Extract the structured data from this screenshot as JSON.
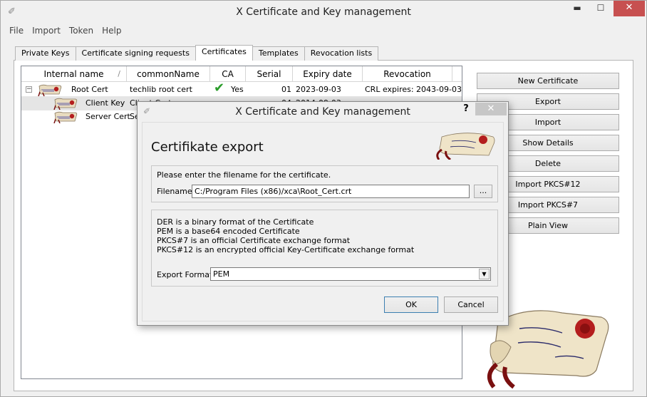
{
  "window": {
    "title": "X Certificate and Key management",
    "minimize": "▬",
    "maximize": "☐",
    "close": "✕"
  },
  "menu": [
    "File",
    "Import",
    "Token",
    "Help"
  ],
  "tabs": [
    "Private Keys",
    "Certificate signing requests",
    "Certificates",
    "Templates",
    "Revocation lists"
  ],
  "active_tab": "Certificates",
  "table": {
    "columns": [
      "Internal name",
      "commonName",
      "CA",
      "Serial",
      "Expiry date",
      "Revocation"
    ],
    "sort_indicator": "/",
    "rows": [
      {
        "name": "Root Cert",
        "cn": "techlib root cert",
        "ca": "Yes",
        "serial": "01",
        "expiry": "2023-09-03",
        "revocation": "CRL expires: 2043-09-03",
        "expander": "−"
      },
      {
        "name": "Client Key",
        "cn": "Client Cert",
        "ca": "",
        "serial": "04",
        "expiry": "2014-09-03",
        "revocation": ""
      },
      {
        "name": "Server Cert",
        "cn": "Se",
        "ca": "",
        "serial": "",
        "expiry": "",
        "revocation": ""
      }
    ]
  },
  "buttons": [
    "New Certificate",
    "Export",
    "Import",
    "Show Details",
    "Delete",
    "Import PKCS#12",
    "Import PKCS#7",
    "Plain View"
  ],
  "dialog": {
    "title": "X Certificate and Key management",
    "help": "?",
    "close": "✕",
    "heading": "Certifikate export",
    "prompt": "Please enter the filename for the certificate.",
    "filename_label": "Filename",
    "filename_value": "C:/Program Files (x86)/xca\\Root_Cert.crt",
    "browse": "...",
    "info": [
      "DER is a binary format of the Certificate",
      "PEM is a base64 encoded Certificate",
      "PKCS#7 is an official Certificate exchange format",
      "PKCS#12 is an encrypted official Key-Certificate exchange format"
    ],
    "format_label": "Export Format",
    "format_value": "PEM",
    "dropdown_arrow": "▼",
    "ok": "OK",
    "cancel": "Cancel"
  },
  "colors": {
    "close_red": "#c75050",
    "check_green": "#2a9c2a",
    "seal_red": "#b41e1e"
  }
}
